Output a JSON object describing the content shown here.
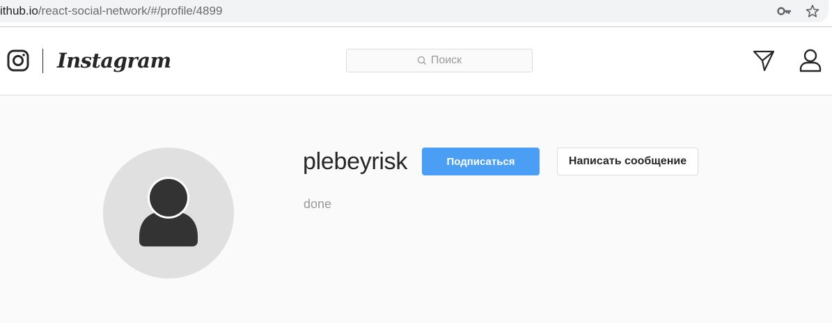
{
  "browser": {
    "url_domain": "ithub.io",
    "url_path": "/react-social-network/#/profile/4899",
    "icons": [
      "key-icon",
      "star-icon"
    ]
  },
  "header": {
    "logo_text": "Instagram",
    "search_placeholder": "Поиск",
    "search_value": "",
    "icons": [
      "instagram-camera-icon",
      "search-icon",
      "paper-plane-icon",
      "user-icon"
    ]
  },
  "profile": {
    "username": "plebeyrisk",
    "follow_label": "Подписаться",
    "message_label": "Написать сообщение",
    "bio": "done",
    "avatar": "default-person-avatar"
  },
  "colors": {
    "accent": "#4a9ff5",
    "page_background": "#fafafa",
    "header_background": "#ffffff",
    "avatar_background": "#e0e0e0",
    "avatar_silhouette": "#333333",
    "muted_text": "#999999"
  }
}
